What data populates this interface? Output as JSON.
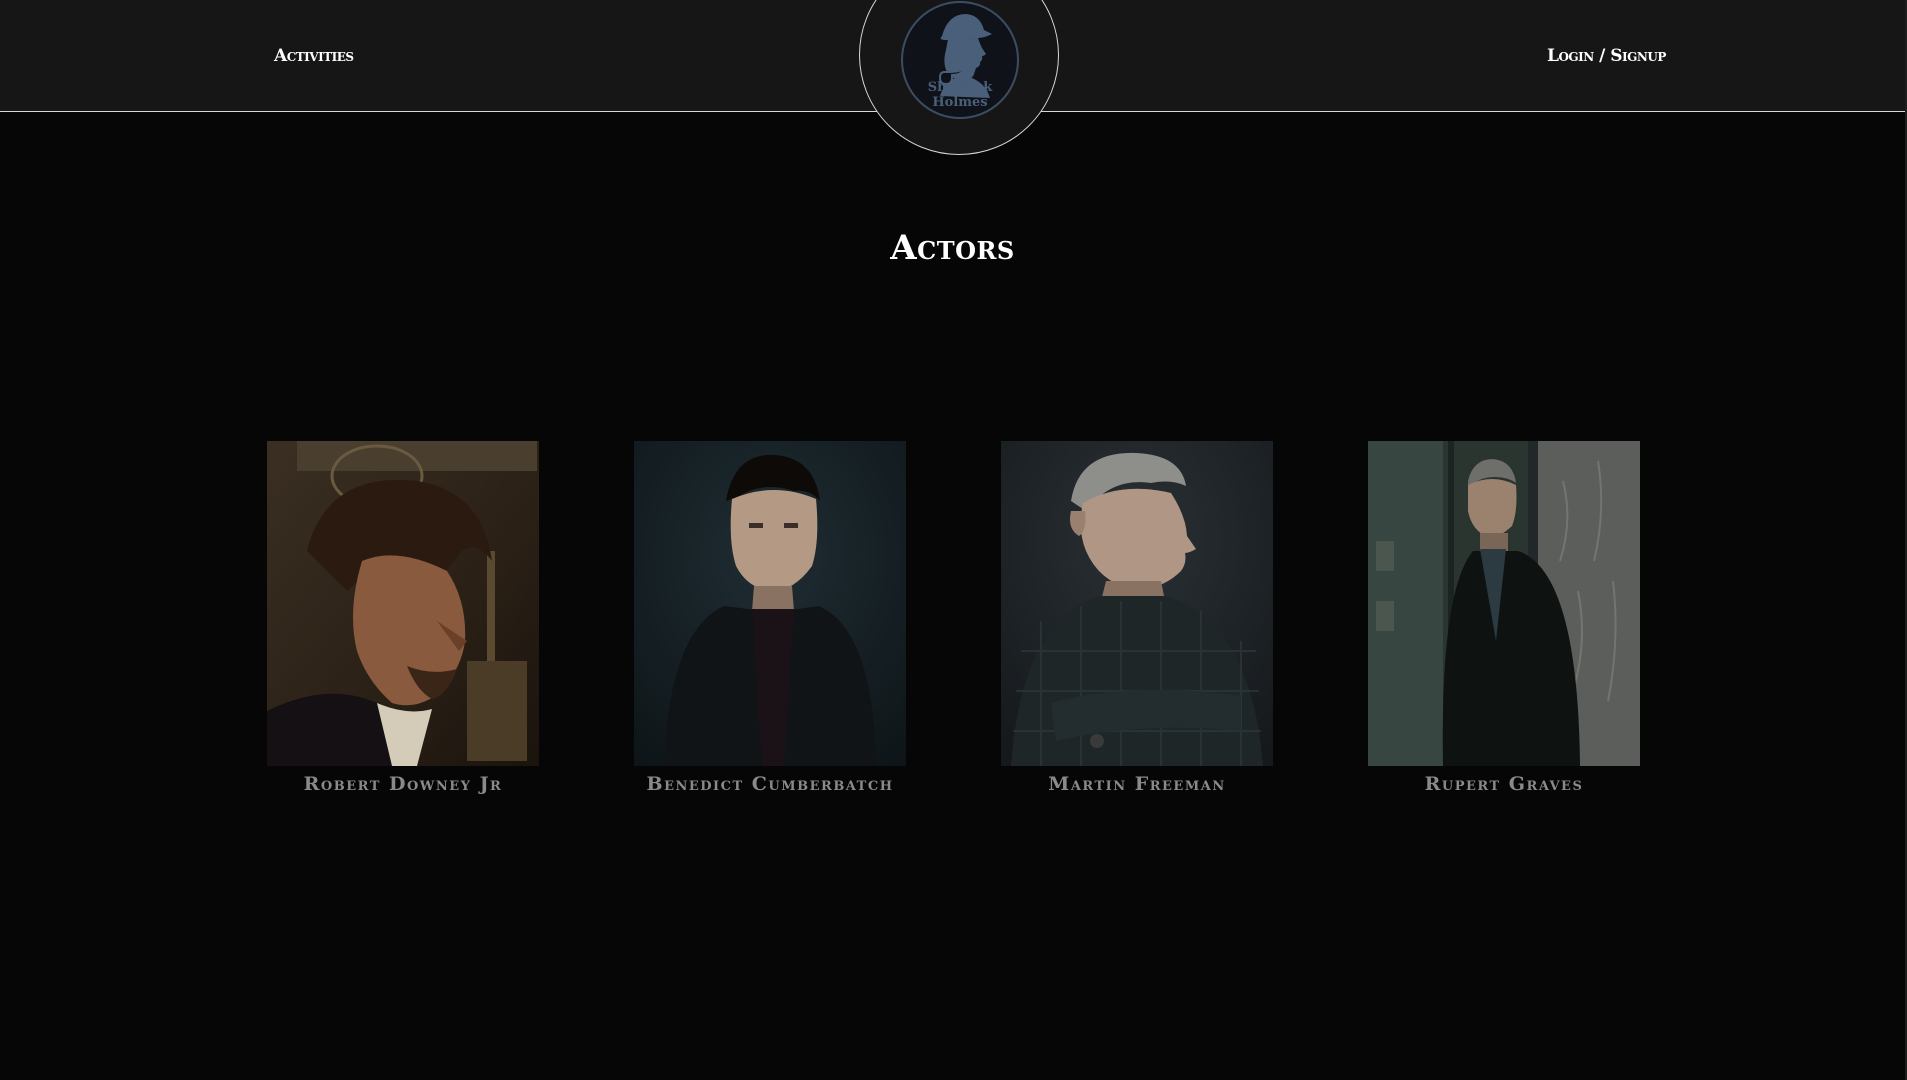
{
  "header": {
    "nav_left": "Activities",
    "nav_right": "Login / Signup",
    "logo_text_line1": "Sherlock",
    "logo_text_line2": "Holmes"
  },
  "main": {
    "title": "Actors",
    "actors": [
      {
        "name": "Robert Downey Jr",
        "photo": "robert-downey-jr-portrait"
      },
      {
        "name": "Benedict Cumberbatch",
        "photo": "benedict-cumberbatch-portrait"
      },
      {
        "name": "Martin Freeman",
        "photo": "martin-freeman-portrait"
      },
      {
        "name": "Rupert Graves",
        "photo": "rupert-graves-portrait"
      }
    ]
  },
  "colors": {
    "page_background": "#060606",
    "header_background": "#161616",
    "logo_blue": "#4a5f7a",
    "actor_name": "#8a8a8a"
  }
}
